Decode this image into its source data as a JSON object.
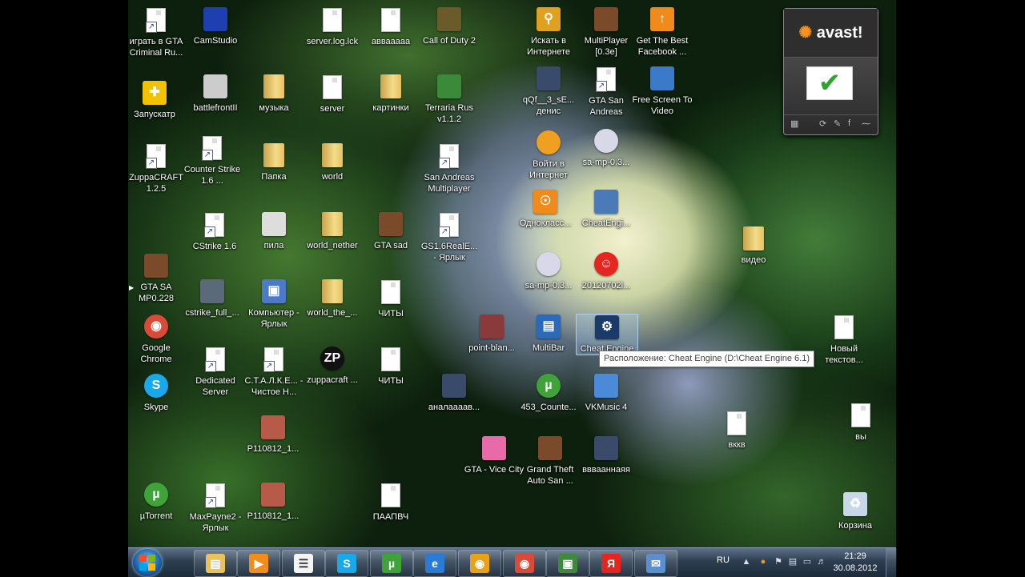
{
  "desktop": {
    "icons": [
      {
        "label": "играть в GTA Criminal Ru...",
        "icon": "gta-doc-icon"
      },
      {
        "label": "CamStudio",
        "icon": "camstudio-icon"
      },
      {
        "label": "server.log.lck",
        "icon": "file-icon"
      },
      {
        "label": "аввааааа",
        "icon": "file-icon"
      },
      {
        "label": "Call of Duty 2",
        "icon": "cod2-icon"
      },
      {
        "label": "Искать в Интернете",
        "icon": "search-web-icon"
      },
      {
        "label": "MultiPlayer [0.3e]",
        "icon": "gta-player-icon"
      },
      {
        "label": "Get The Best Facebook ...",
        "icon": "facebook-app-icon"
      },
      {
        "label": "Запускатр",
        "icon": "launcher-icon"
      },
      {
        "label": "battlefrontII",
        "icon": "stormtrooper-icon"
      },
      {
        "label": "музыка",
        "icon": "folder-icon"
      },
      {
        "label": "server",
        "icon": "file-icon"
      },
      {
        "label": "картинки",
        "icon": "folder-icon"
      },
      {
        "label": "Terraria Rus v1.1.2",
        "icon": "terraria-icon"
      },
      {
        "label": "qQf__3_sE... денис",
        "icon": "image-file-icon"
      },
      {
        "label": "GTA San Andreas",
        "icon": "gta-doc-icon"
      },
      {
        "label": "Free Screen To Video",
        "icon": "screen-video-icon"
      },
      {
        "label": "ZuppaCRAFT 1.2.5",
        "icon": "doc-shortcut-icon"
      },
      {
        "label": "Counter Strike 1.6 ...",
        "icon": "doc-shortcut-icon"
      },
      {
        "label": "Папка",
        "icon": "folder-icon"
      },
      {
        "label": "world",
        "icon": "folder-icon"
      },
      {
        "label": "San Andreas Multiplayer",
        "icon": "doc-shortcut-icon"
      },
      {
        "label": "Войти в Интернет",
        "icon": "internet-icon"
      },
      {
        "label": "sa-mp-0.3...",
        "icon": "samp-installer-icon"
      },
      {
        "label": "Однокласс...",
        "icon": "odnoklassniki-icon"
      },
      {
        "label": "CheatEngi...",
        "icon": "cheat-engine-installer-icon"
      },
      {
        "label": "CStrike 1.6",
        "icon": "doc-shortcut-icon"
      },
      {
        "label": "пила",
        "icon": "saw-icon"
      },
      {
        "label": "world_nether",
        "icon": "folder-icon"
      },
      {
        "label": "GTA sad",
        "icon": "gta-player-icon"
      },
      {
        "label": "GS1.6RealE... - Ярлык",
        "icon": "doc-shortcut-icon"
      },
      {
        "label": "видео",
        "icon": "folder-icon"
      },
      {
        "label": "GTA SA MP0.228",
        "icon": "gta-player-icon"
      },
      {
        "label": "sa-mp-0.3...",
        "icon": "samp-installer-icon"
      },
      {
        "label": "20120702l...",
        "icon": "chat-bubble-icon"
      },
      {
        "label": "cstrike_full_...",
        "icon": "cs-icon"
      },
      {
        "label": "Компьютер - Ярлык",
        "icon": "computer-icon"
      },
      {
        "label": "world_the_...",
        "icon": "folder-icon"
      },
      {
        "label": "ЧИТЫ",
        "icon": "file-icon"
      },
      {
        "label": "Google Chrome",
        "icon": "chrome-icon"
      },
      {
        "label": "point-blan...",
        "icon": "point-blank-icon"
      },
      {
        "label": "MultiBar",
        "icon": "multibar-icon"
      },
      {
        "label": "Cheat Engine",
        "icon": "cheat-engine-icon"
      },
      {
        "label": "Новый текстов...",
        "icon": "file-icon"
      },
      {
        "label": "Dedicated Server",
        "icon": "doc-shortcut-icon"
      },
      {
        "label": "С.Т.А.Л.К.Е... - Чистое Н...",
        "icon": "doc-shortcut-icon"
      },
      {
        "label": "zuppacraft ...",
        "icon": "zp-icon"
      },
      {
        "label": "ЧИТЫ",
        "icon": "file-icon"
      },
      {
        "label": "Skype",
        "icon": "skype-icon"
      },
      {
        "label": "аналаааав...",
        "icon": "image-file-icon"
      },
      {
        "label": "453_Counte...",
        "icon": "utorrent-icon"
      },
      {
        "label": "VKMusic 4",
        "icon": "vkmusic-icon"
      },
      {
        "label": "вккв",
        "icon": "file-icon"
      },
      {
        "label": "вы",
        "icon": "file-icon"
      },
      {
        "label": "P110812_1...",
        "icon": "photo-icon"
      },
      {
        "label": "GTA - Vice City",
        "icon": "vice-city-icon"
      },
      {
        "label": "Grand Theft Auto San ...",
        "icon": "gta-player-icon"
      },
      {
        "label": "вввааннаяя",
        "icon": "image-file-icon"
      },
      {
        "label": "µTorrent",
        "icon": "utorrent-icon"
      },
      {
        "label": "MaxPayne2 - Ярлык",
        "icon": "doc-shortcut-icon"
      },
      {
        "label": "P110812_1...",
        "icon": "photo-icon"
      },
      {
        "label": "ПААПВЧ",
        "icon": "file-icon"
      },
      {
        "label": "Корзина",
        "icon": "recycle-bin-icon"
      }
    ]
  },
  "tooltip": {
    "text": "Расположение: Cheat Engine (D:\\Cheat Engine 6.1)"
  },
  "avast": {
    "brand": "avast!",
    "status": "protected"
  },
  "taskbar": {
    "items": [
      {
        "name": "explorer",
        "icon": "folder-icon",
        "color": "#e8c25a"
      },
      {
        "name": "media",
        "icon": "media-player-icon",
        "color": "#f28c1a"
      },
      {
        "name": "notepad",
        "icon": "notepad-icon",
        "color": "#f4f4f4"
      },
      {
        "name": "skype",
        "icon": "skype-icon",
        "color": "#19a8e8"
      },
      {
        "name": "utorrent",
        "icon": "utorrent-icon",
        "color": "#3fa33a"
      },
      {
        "name": "ie",
        "icon": "internet-explorer-icon",
        "color": "#2a7bd6"
      },
      {
        "name": "nero",
        "icon": "app-icon",
        "color": "#e8a21a"
      },
      {
        "name": "chrome",
        "icon": "chrome-icon",
        "color": "#d94a38"
      },
      {
        "name": "monitor",
        "icon": "monitor-icon",
        "color": "#3e8a3a"
      },
      {
        "name": "yandex",
        "icon": "yandex-icon",
        "color": "#e52620"
      },
      {
        "name": "mail",
        "icon": "mail-icon",
        "color": "#5a8fd0"
      }
    ],
    "language": "RU",
    "time": "21:29",
    "date": "30.08.2012"
  }
}
